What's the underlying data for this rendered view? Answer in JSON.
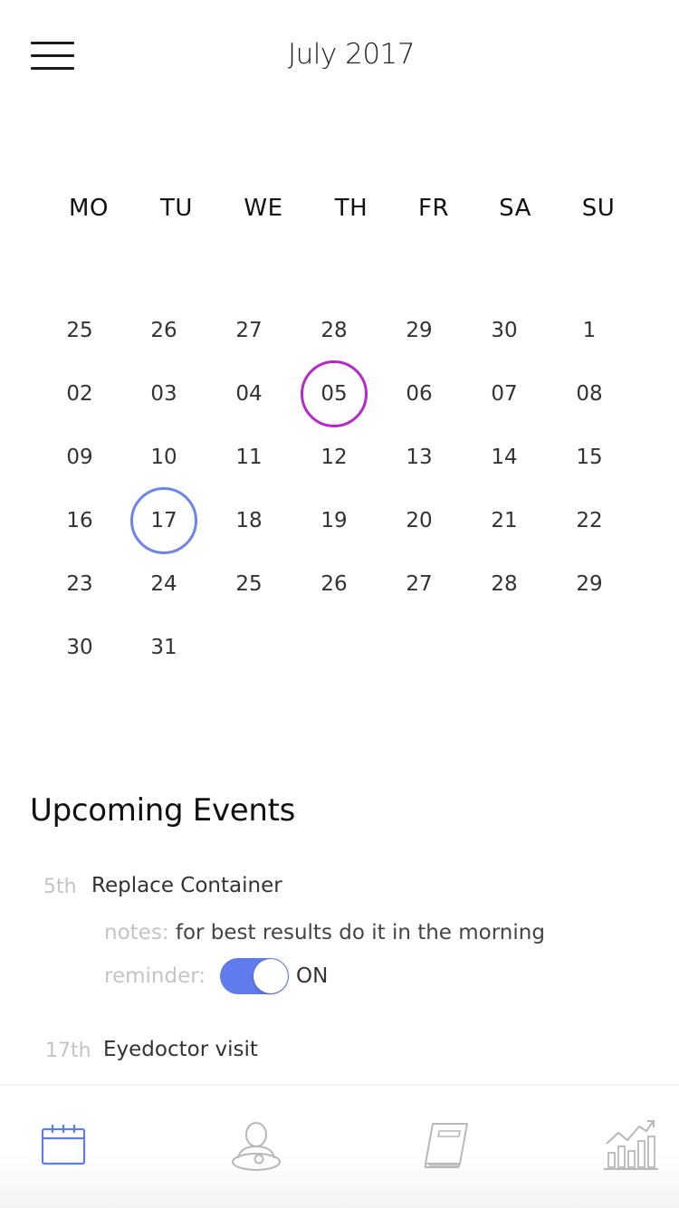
{
  "header": {
    "title": "July 2017",
    "menu_icon": "hamburger-menu-icon"
  },
  "weekdays": [
    "MO",
    "TU",
    "WE",
    "TH",
    "FR",
    "SA",
    "SU"
  ],
  "calendar_days": [
    [
      "25",
      "26",
      "27",
      "28",
      "29",
      "30",
      "1"
    ],
    [
      "02",
      "03",
      "04",
      "05",
      "06",
      "07",
      "08"
    ],
    [
      "09",
      "10",
      "11",
      "12",
      "13",
      "14",
      "15"
    ],
    [
      "16",
      "17",
      "18",
      "19",
      "20",
      "21",
      "22"
    ],
    [
      "23",
      "24",
      "25",
      "26",
      "27",
      "28",
      "29"
    ],
    [
      "30",
      "31"
    ]
  ],
  "highlighted_days": [
    {
      "row": 1,
      "col": 3,
      "color": "#b628cc"
    },
    {
      "row": 3,
      "col": 1,
      "color": "#6a85ee"
    }
  ],
  "events": {
    "title": "Upcoming Events",
    "items": [
      {
        "date": "5th",
        "name": "Replace Container",
        "notes_label": "notes:",
        "notes_text": "for best results do it in the morning",
        "reminder_label": "reminder:",
        "reminder_state": "ON"
      },
      {
        "date": "17th",
        "name": "Eyedoctor visit"
      }
    ]
  },
  "tabs": [
    {
      "icon": "calendar-icon",
      "active": true
    },
    {
      "icon": "profile-icon",
      "active": false
    },
    {
      "icon": "notebook-icon",
      "active": false
    },
    {
      "icon": "statistics-chart-icon",
      "active": false
    }
  ],
  "colors": {
    "accent_blue": "#5f7bec",
    "accent_purple": "#b628cc",
    "muted_text": "#c4c4c4",
    "inactive_icon": "#b8b8b8"
  }
}
